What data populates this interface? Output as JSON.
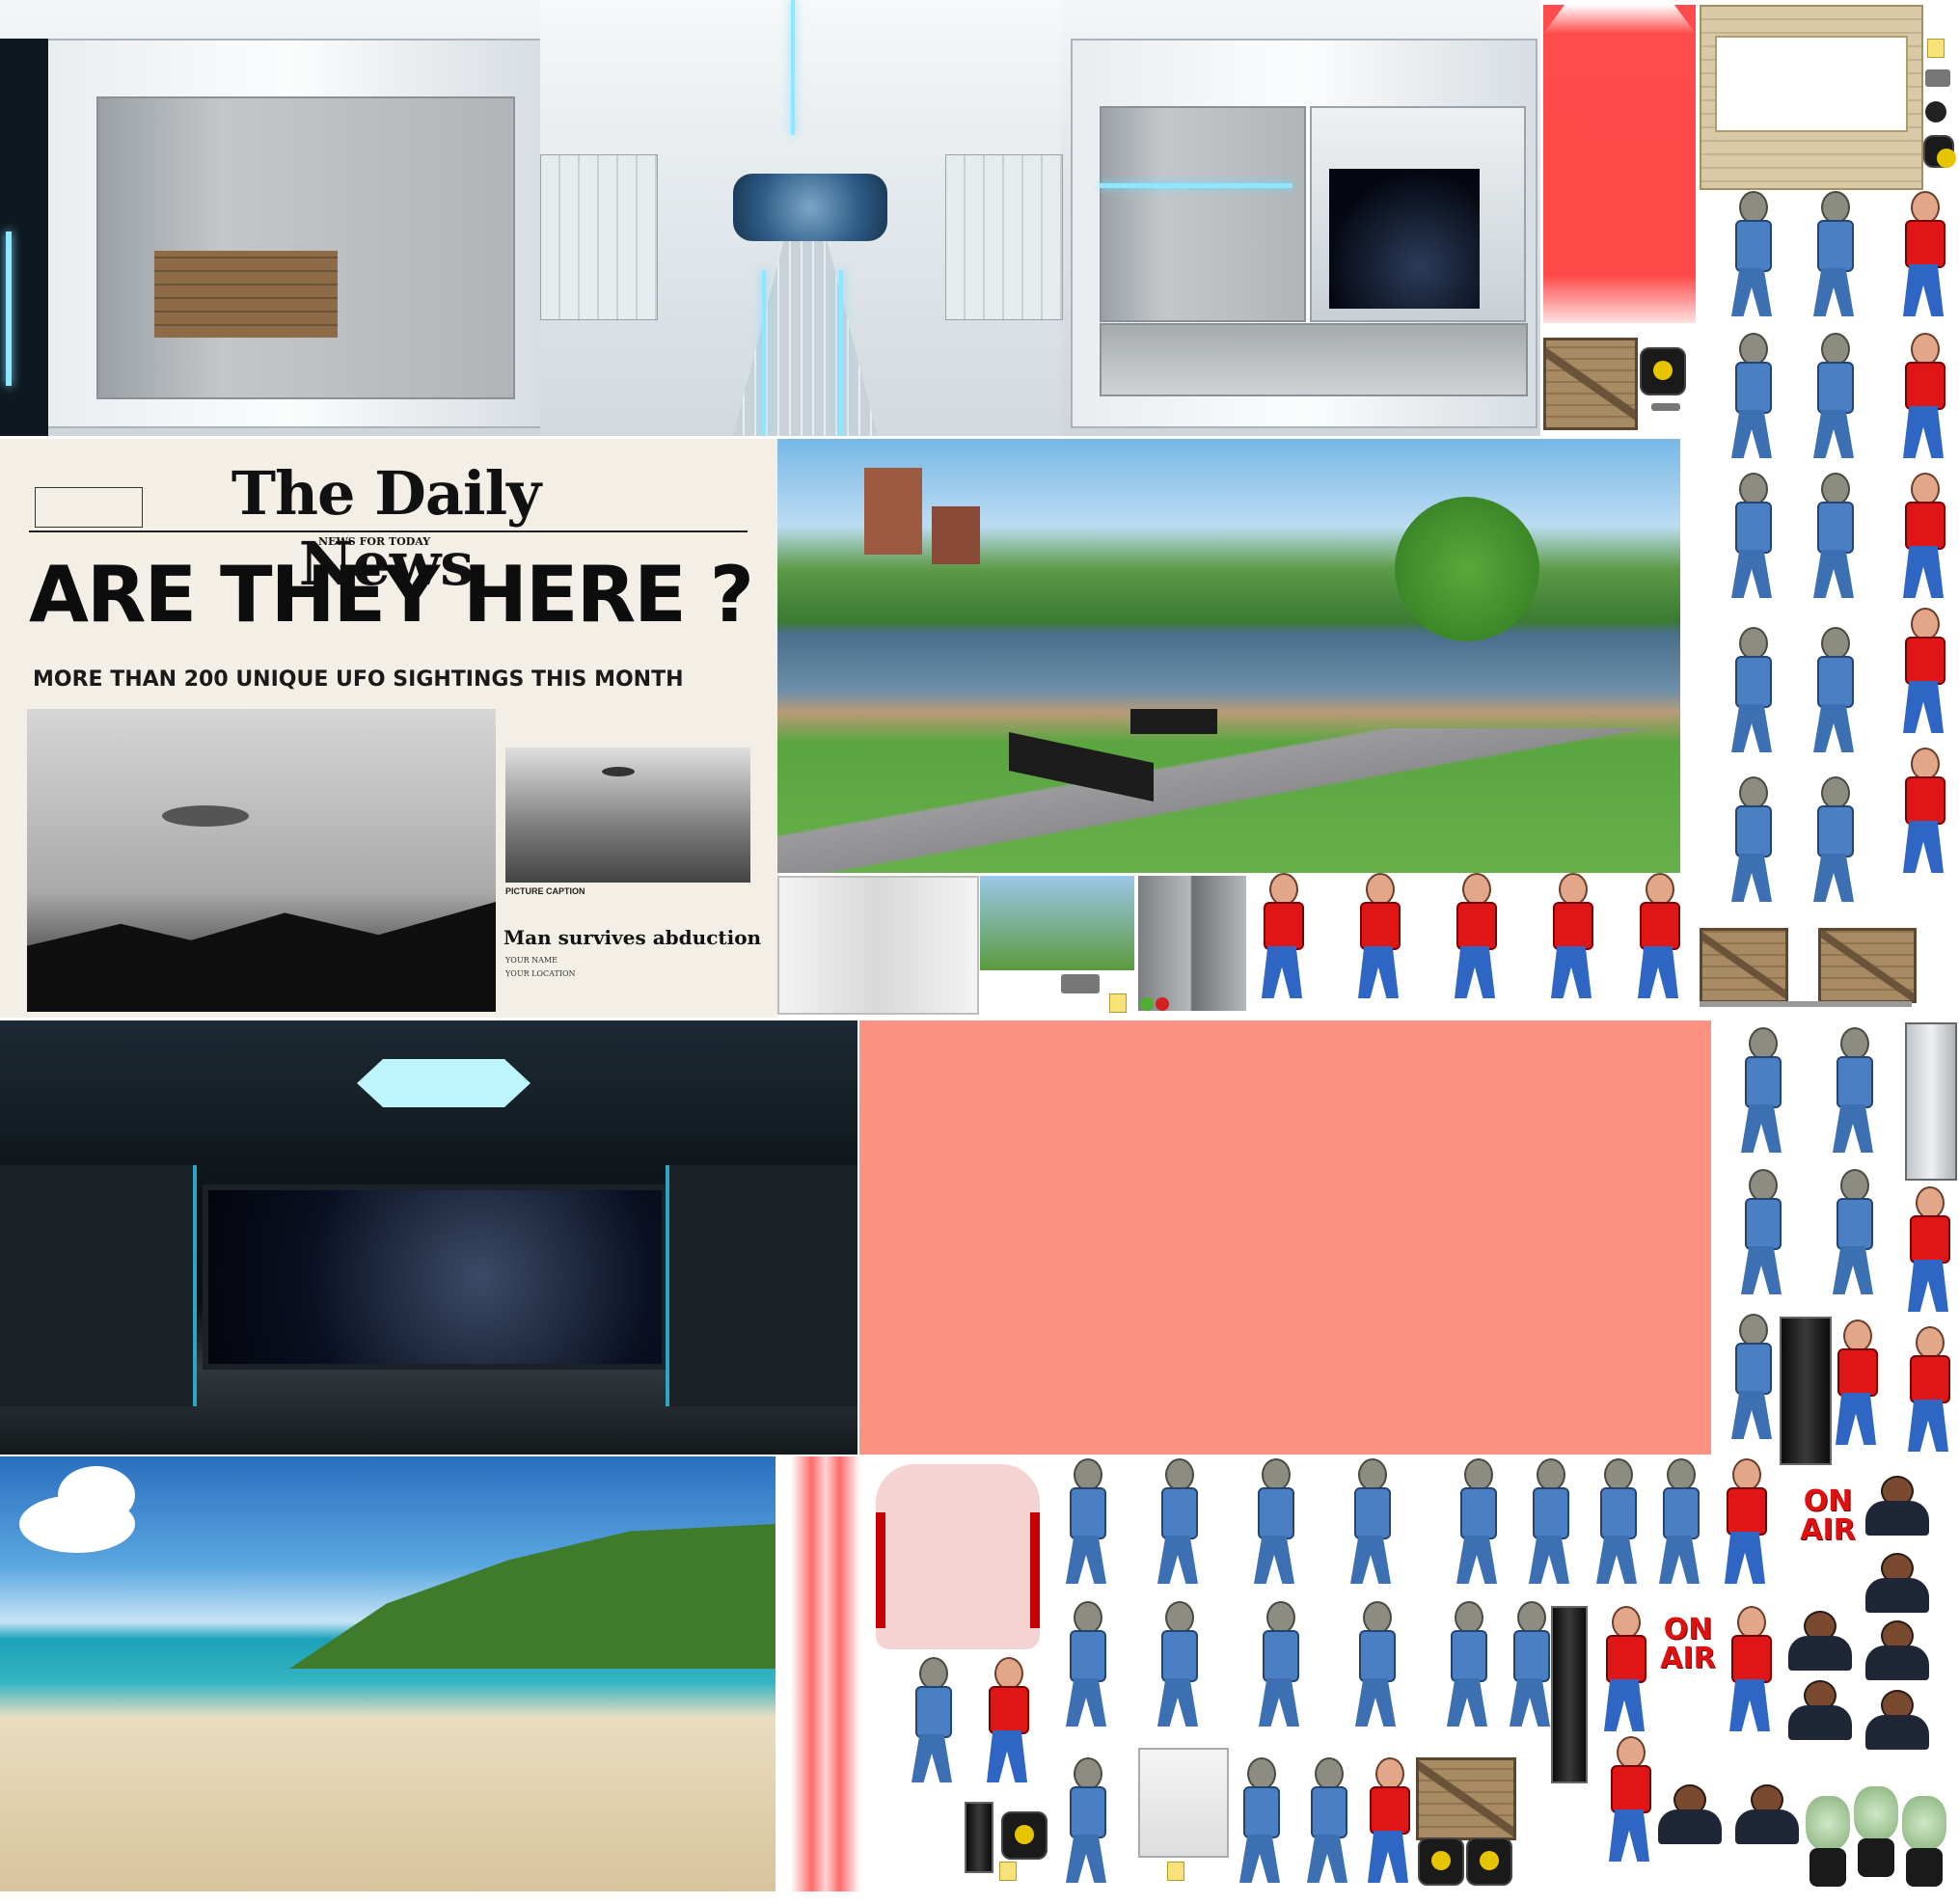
{
  "sheet": {
    "title": "",
    "colors": {
      "red_swatch": "#ff4b4b",
      "salmon_swatch": "#fd9282",
      "background": "#ffffff"
    }
  },
  "newspaper": {
    "masthead": "The Daily News",
    "subhead": "NEWS FOR TODAY",
    "headline": "ARE THEY HERE ?",
    "deck": "MORE THAN 200 UNIQUE UFO SIGHTINGS THIS MONTH",
    "photo_caption": "PICTURE CAPTION",
    "story_title": "Man survives abduction",
    "story_byline_1": "YOUR NAME",
    "story_byline_2": "YOUR LOCATION"
  },
  "signs": {
    "on_air_1": "ON AIR",
    "on_air_2": "ON AIR"
  },
  "sprites": {
    "alien_icon": "alien-walk-icon",
    "man_icon": "bald-man-red-shirt-icon",
    "anchor_icon": "news-anchor-icon",
    "crate_icon": "wooden-crate-icon",
    "barrel_icon": "hazard-barrel-icon",
    "plant_icon": "potted-plant-icon"
  }
}
